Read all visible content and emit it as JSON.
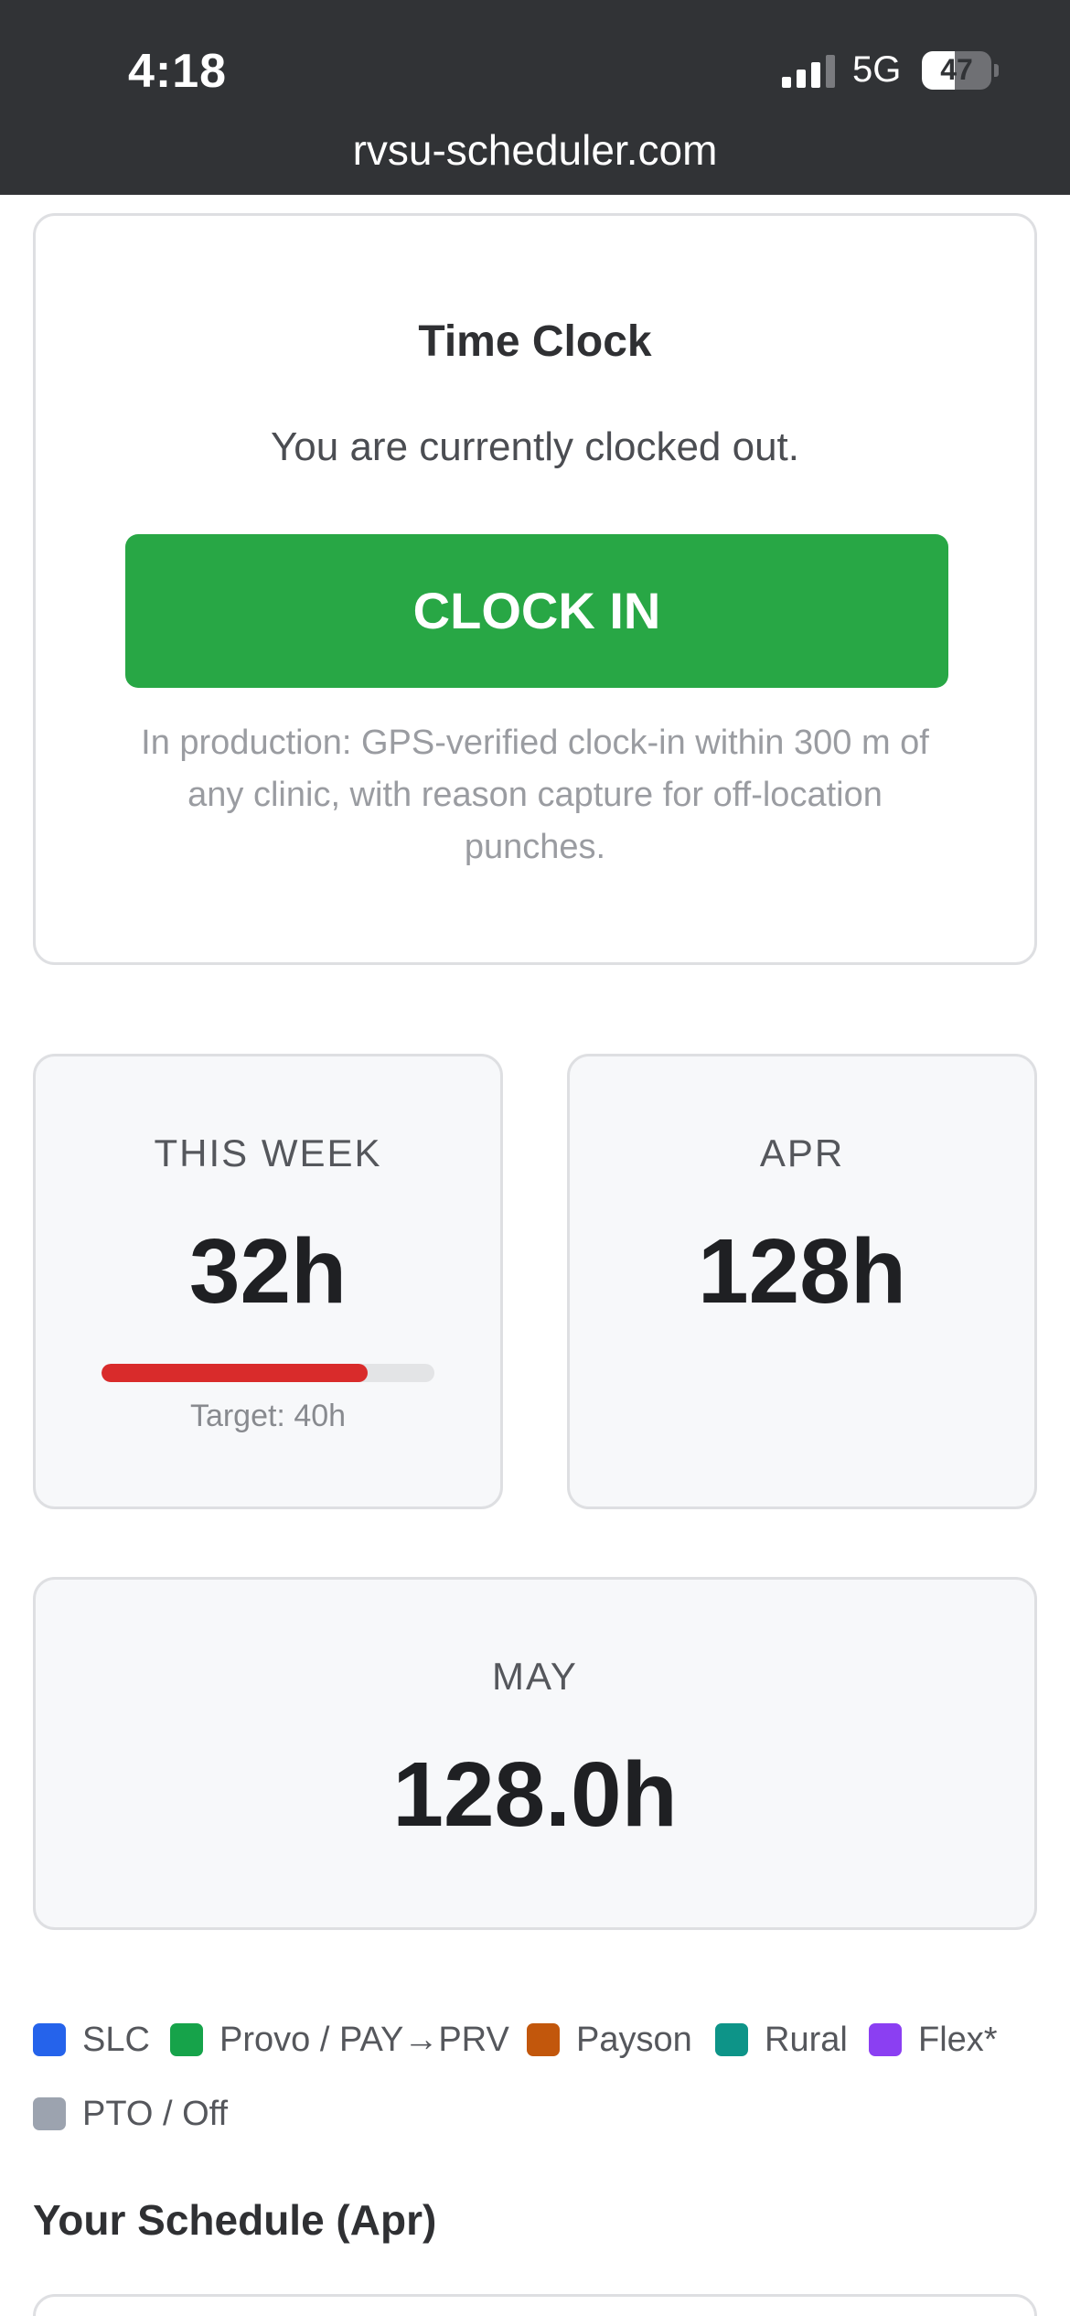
{
  "status_bar": {
    "time": "4:18",
    "network": "5G",
    "battery": "47",
    "battery_level": 0.47
  },
  "browser": {
    "url": "rvsu-scheduler.com"
  },
  "time_clock": {
    "title": "Time Clock",
    "status": "You are currently clocked out.",
    "button_label": "CLOCK IN",
    "note": "In production: GPS-verified clock-in within 300 m of any clinic, with reason capture for off-location punches."
  },
  "stats": {
    "this_week": {
      "label": "THIS WEEK",
      "value": "32h",
      "progress": 0.8,
      "target": "Target: 40h"
    },
    "apr": {
      "label": "APR",
      "value": "128h"
    },
    "may": {
      "label": "MAY",
      "value": "128.0h"
    }
  },
  "colors": {
    "clock_in_green": "#28a745",
    "progress_red": "#d92b2b"
  },
  "legend": [
    {
      "label": "SLC",
      "color": "#2563eb"
    },
    {
      "label": "Provo / PAY→PRV",
      "color": "#16a34a"
    },
    {
      "label": "Payson",
      "color": "#c2570c"
    },
    {
      "label": "Rural",
      "color": "#0d9488"
    },
    {
      "label": "Flex*",
      "color": "#8b3ff2"
    },
    {
      "label": "PTO / Off",
      "color": "#9ca3af"
    }
  ],
  "schedule": {
    "title": "Your Schedule (Apr)"
  }
}
